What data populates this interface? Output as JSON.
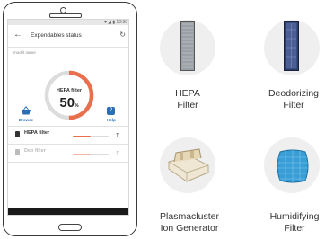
{
  "phone": {
    "status_time": "▼◢ ▮ 12:30",
    "app_title": "Expendables status",
    "model_label": "model name",
    "gauge": {
      "title": "HEPA filter",
      "value": "50",
      "unit": "%",
      "level": 0.5,
      "accent": "#e8704d"
    },
    "browse_label": "Browse",
    "help_label": "Help",
    "rows": [
      {
        "label": "HEPA filter",
        "level": 0.5,
        "active": true
      },
      {
        "label": "Deo filter",
        "level": 0.5,
        "active": false
      }
    ]
  },
  "products": [
    {
      "line1": "HEPA",
      "line2": "Filter",
      "icon": "hepa-filter-icon"
    },
    {
      "line1": "Deodorizing",
      "line2": "Filter",
      "icon": "deodorizing-filter-icon"
    },
    {
      "line1": "Plasmacluster",
      "line2": "Ion Generator",
      "icon": "ion-generator-icon"
    },
    {
      "line1": "Humidifying",
      "line2": "Filter",
      "icon": "humidifying-filter-icon"
    }
  ],
  "colors": {
    "accent": "#e8704d",
    "link": "#2a6fb6"
  }
}
